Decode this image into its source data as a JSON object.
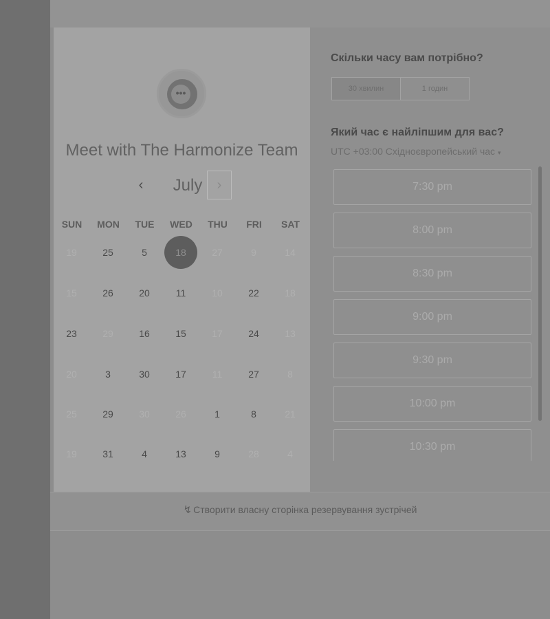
{
  "calendar": {
    "title": "Meet with The Harmonize Team",
    "month": "July",
    "prev_label": "‹",
    "next_label": "›",
    "avatar_glyph": "•••",
    "weekdays": [
      "SUN",
      "MON",
      "TUE",
      "WED",
      "THU",
      "FRI",
      "SAT"
    ],
    "weeks": [
      [
        {
          "d": "19",
          "a": false
        },
        {
          "d": "25",
          "a": true
        },
        {
          "d": "5",
          "a": true
        },
        {
          "d": "18",
          "a": true,
          "sel": true
        },
        {
          "d": "27",
          "a": false
        },
        {
          "d": "9",
          "a": false
        },
        {
          "d": "14",
          "a": false
        }
      ],
      [
        {
          "d": "15",
          "a": false
        },
        {
          "d": "26",
          "a": true
        },
        {
          "d": "20",
          "a": true
        },
        {
          "d": "11",
          "a": true
        },
        {
          "d": "10",
          "a": false
        },
        {
          "d": "22",
          "a": true
        },
        {
          "d": "18",
          "a": false
        }
      ],
      [
        {
          "d": "23",
          "a": true
        },
        {
          "d": "29",
          "a": false
        },
        {
          "d": "16",
          "a": true
        },
        {
          "d": "15",
          "a": true
        },
        {
          "d": "17",
          "a": false
        },
        {
          "d": "24",
          "a": true
        },
        {
          "d": "13",
          "a": false
        }
      ],
      [
        {
          "d": "20",
          "a": false
        },
        {
          "d": "3",
          "a": true
        },
        {
          "d": "30",
          "a": true
        },
        {
          "d": "17",
          "a": true
        },
        {
          "d": "11",
          "a": false
        },
        {
          "d": "27",
          "a": true
        },
        {
          "d": "8",
          "a": false
        }
      ],
      [
        {
          "d": "25",
          "a": false
        },
        {
          "d": "29",
          "a": true
        },
        {
          "d": "30",
          "a": false
        },
        {
          "d": "26",
          "a": false
        },
        {
          "d": "1",
          "a": true
        },
        {
          "d": "8",
          "a": true
        },
        {
          "d": "21",
          "a": false
        }
      ],
      [
        {
          "d": "19",
          "a": false
        },
        {
          "d": "31",
          "a": true
        },
        {
          "d": "4",
          "a": true
        },
        {
          "d": "13",
          "a": true
        },
        {
          "d": "9",
          "a": true
        },
        {
          "d": "28",
          "a": false
        },
        {
          "d": "4",
          "a": false
        }
      ]
    ]
  },
  "booking": {
    "duration_question": "Скільки часу вам потрібно?",
    "durations": [
      {
        "label": "30 хвилин",
        "active": true
      },
      {
        "label": "1 годин",
        "active": false
      }
    ],
    "time_question": "Який час є найліпшим для вас?",
    "timezone": "UTC +03:00 Східноєвропейський час",
    "timezone_caret": "▾",
    "slots": [
      "7:30 pm",
      "8:00 pm",
      "8:30 pm",
      "9:00 pm",
      "9:30 pm",
      "10:00 pm",
      "10:30 pm"
    ]
  },
  "footer": {
    "icon": "↯",
    "link": "Створити власну сторінка резервування зустрічей"
  }
}
